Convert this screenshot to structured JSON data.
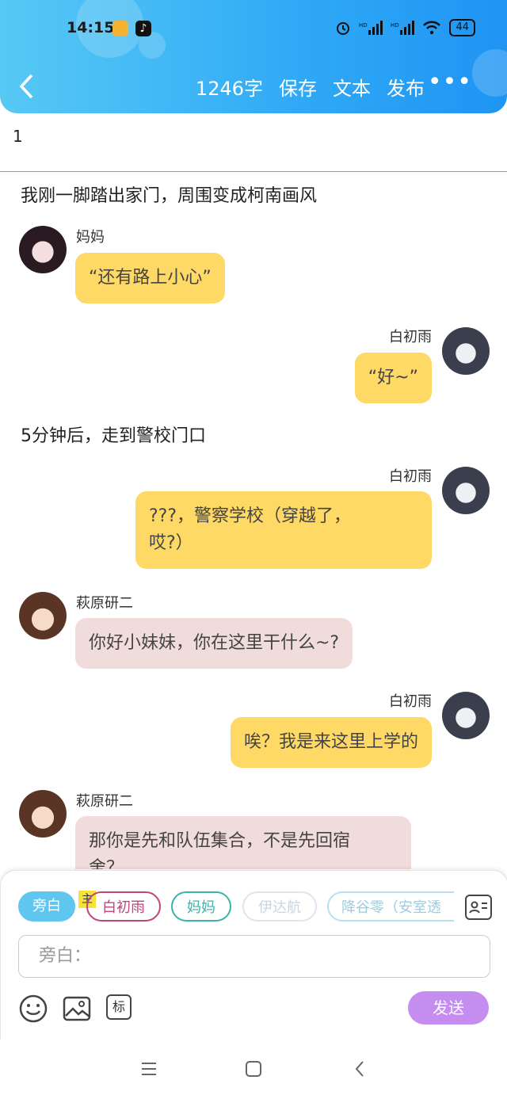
{
  "status_bar": {
    "time": "14:15",
    "battery": "44"
  },
  "nav": {
    "word_count": "1246字",
    "save": "保存",
    "text": "文本",
    "publish": "发布",
    "more": "•••"
  },
  "doc": {
    "title": "1"
  },
  "messages": [
    {
      "type": "narration",
      "text": "我刚一脚踏出家门，周围变成柯南画风"
    },
    {
      "type": "left",
      "name": "妈妈",
      "text": "“还有路上小心”"
    },
    {
      "type": "right",
      "name": "白初雨",
      "text": "“好~”"
    },
    {
      "type": "narration",
      "text": "5分钟后，走到警校门口"
    },
    {
      "type": "right",
      "name": "白初雨",
      "text_line1": "???，警察学校（穿越了，",
      "text_line2": "哎?）"
    },
    {
      "type": "left",
      "name": "萩原研二",
      "text": "你好小妹妹，你在这里干什么~?"
    },
    {
      "type": "right",
      "name": "白初雨",
      "text": "唉？我是来这里上学的"
    },
    {
      "type": "left",
      "name": "萩原研二",
      "text_line1": "那你是先和队伍集合，不是先回宿",
      "text_line2": "舍？"
    }
  ],
  "composer": {
    "characters": [
      "旁白",
      "白初雨",
      "妈妈",
      "伊达航",
      "降谷零（安室透"
    ],
    "main_badge": "主",
    "placeholder": "旁白：",
    "mark_label": "标",
    "send_label": "发送"
  },
  "colors": {
    "header": "#2fa9f6",
    "bubble_self": "#ffd966",
    "bubble_other": "#f1dcdc",
    "send": "#c58df0"
  }
}
